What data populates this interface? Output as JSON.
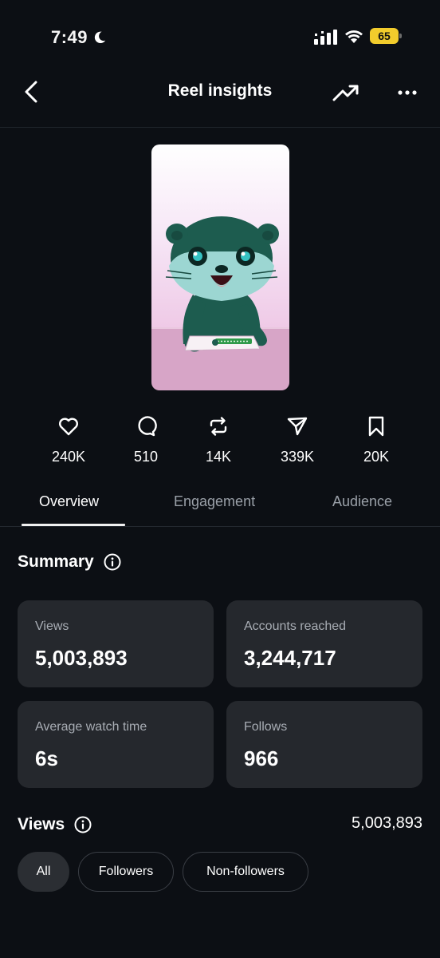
{
  "status_bar": {
    "time": "7:49",
    "battery": "65"
  },
  "header": {
    "title": "Reel insights"
  },
  "stats": [
    {
      "icon": "heart-icon",
      "value": "240K"
    },
    {
      "icon": "comment-icon",
      "value": "510"
    },
    {
      "icon": "repost-icon",
      "value": "14K"
    },
    {
      "icon": "share-icon",
      "value": "339K"
    },
    {
      "icon": "bookmark-icon",
      "value": "20K"
    }
  ],
  "tabs": [
    {
      "label": "Overview",
      "active": true
    },
    {
      "label": "Engagement",
      "active": false
    },
    {
      "label": "Audience",
      "active": false
    }
  ],
  "summary": {
    "title": "Summary",
    "cards": [
      {
        "label": "Views",
        "value": "5,003,893"
      },
      {
        "label": "Accounts reached",
        "value": "3,244,717"
      },
      {
        "label": "Average watch time",
        "value": "6s"
      },
      {
        "label": "Follows",
        "value": "966"
      }
    ]
  },
  "views": {
    "title": "Views",
    "total": "5,003,893",
    "filters": [
      {
        "label": "All",
        "active": true
      },
      {
        "label": "Followers",
        "active": false
      },
      {
        "label": "Non-followers",
        "active": false
      }
    ]
  },
  "colors": {
    "background": "#0c0f14",
    "card": "#25282d",
    "battery": "#f2cc2c"
  }
}
